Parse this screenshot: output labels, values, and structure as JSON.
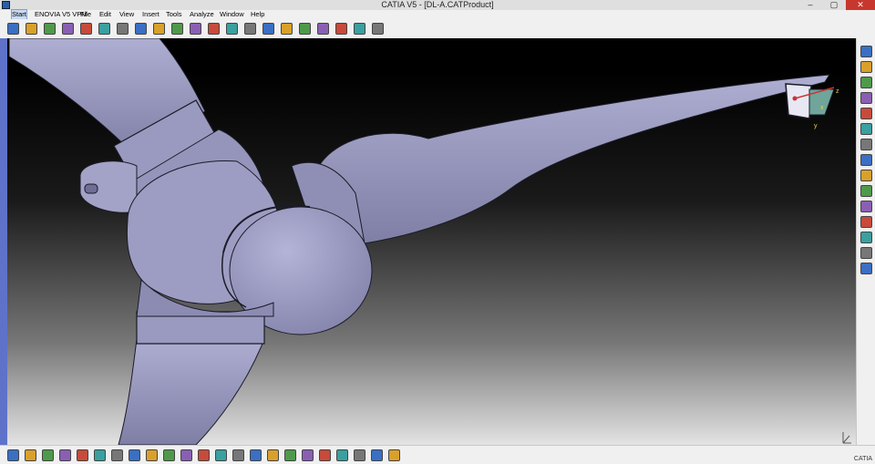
{
  "window": {
    "title": "CATIA V5 - [DL-A.CATProduct]",
    "controls": {
      "minimize": "–",
      "restore": "▢",
      "close": "✕"
    }
  },
  "menubar": {
    "items": [
      {
        "label": "Start",
        "active": true
      },
      {
        "label": "ENOVIA V5 VPM"
      },
      {
        "label": "File"
      },
      {
        "label": "Edit"
      },
      {
        "label": "View"
      },
      {
        "label": "Insert"
      },
      {
        "label": "Tools"
      },
      {
        "label": "Analyze"
      },
      {
        "label": "Window"
      },
      {
        "label": "Help"
      }
    ]
  },
  "compass": {
    "axis_x": "x",
    "axis_y": "y",
    "axis_z": "z"
  },
  "brand": {
    "text": "CATIA"
  },
  "colors": {
    "model_fill": "#9797bd",
    "model_dark": "#6e6e96",
    "edge": "#1b1b28",
    "accent_blue": "#5f72c9"
  },
  "icons": {
    "top_toolbar": [
      "sketch-icon",
      "part-icon",
      "product-icon",
      "assembly-icon",
      "pencil-icon",
      "plane-icon",
      "catalog-icon",
      "knowledge-icon",
      "graph-icon",
      "update-icon",
      "magnify-icon",
      "fit-all-icon",
      "normal-view-icon",
      "pan-icon",
      "measure-icon",
      "simulation-icon",
      "constraint-icon",
      "snap-icon",
      "multi-view-icon",
      "explode-icon",
      "clash-icon"
    ],
    "right_toolbar": [
      "compass-tool-icon",
      "select-arrow-icon",
      "rotate-tool-icon",
      "assembly-tool-icon",
      "manipulate-icon",
      "snap-tool-icon",
      "constraint-tool-icon",
      "coincidence-icon",
      "contact-icon",
      "offset-icon",
      "angle-icon",
      "fix-icon",
      "fix-together-icon",
      "reuse-pattern-icon",
      "update-tool-icon"
    ],
    "bottom_toolbar": [
      "formula-icon",
      "comment-icon",
      "display-mode-icon",
      "tree-icon",
      "hide-icon",
      "swap-icon",
      "fly-mode-icon",
      "fit-all-bottom-icon",
      "pan-bottom-icon",
      "rotate-bottom-icon",
      "zoom-in-icon",
      "zoom-out-icon",
      "normal-bottom-icon",
      "iso-view-icon",
      "shading-icon",
      "hide-show-icon",
      "view-mode-icon",
      "light-icon",
      "camera-icon",
      "capture-icon",
      "measure-between-icon",
      "measure-item-icon",
      "grid-icon"
    ]
  }
}
